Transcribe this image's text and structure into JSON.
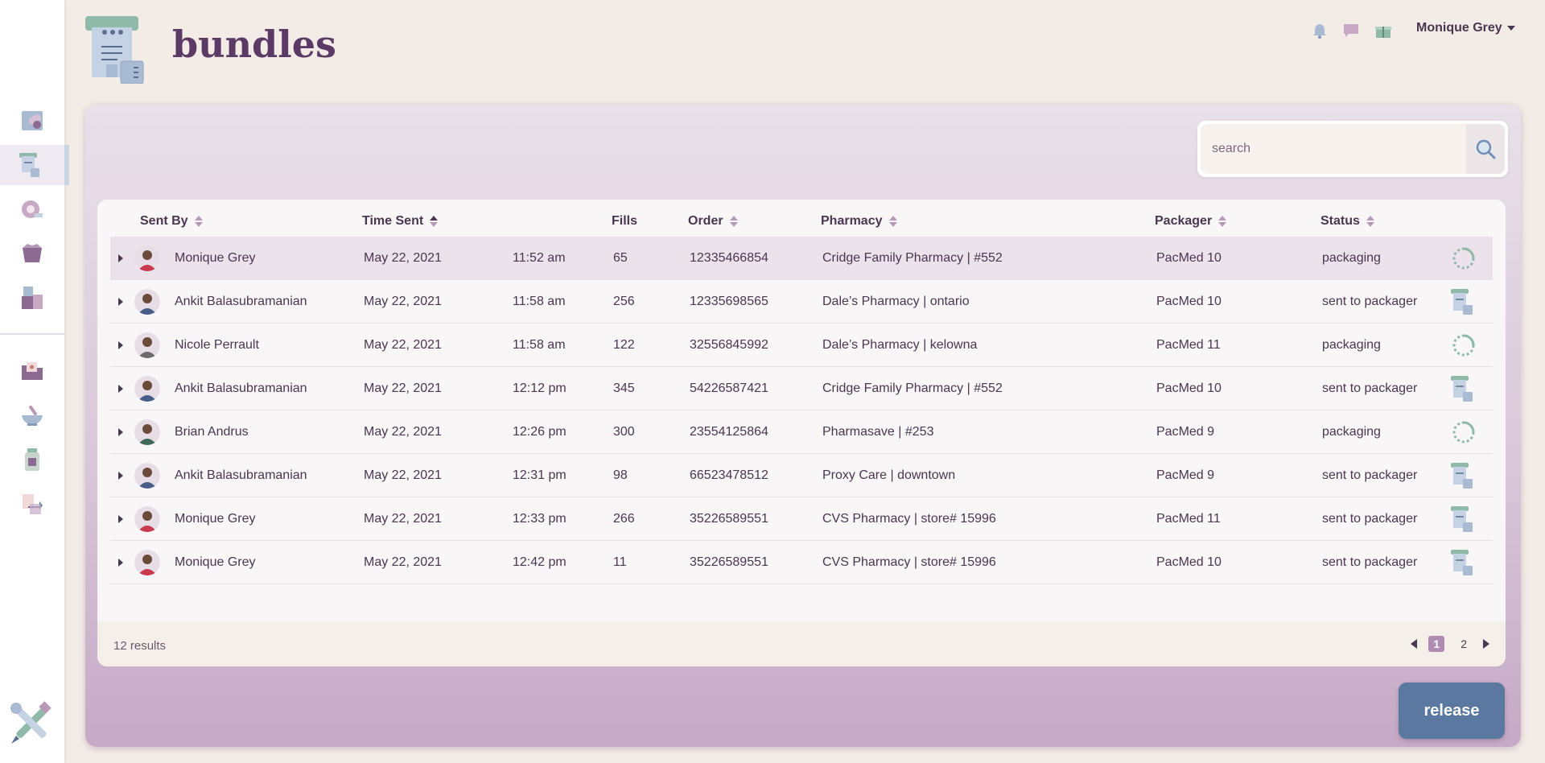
{
  "page": {
    "title": "bundles"
  },
  "header": {
    "user_name": "Monique Grey",
    "icons": [
      "bell-icon",
      "chat-icon",
      "gift-icon"
    ]
  },
  "sidebar": {
    "items": [
      {
        "name": "pills-icon",
        "active": false
      },
      {
        "name": "bundles-icon",
        "active": true
      },
      {
        "name": "tape-icon",
        "active": false
      },
      {
        "name": "box-icon",
        "active": false
      },
      {
        "name": "stack-icon",
        "active": false
      },
      {
        "name": "folder-icon",
        "active": false
      },
      {
        "name": "mortar-pestle-icon",
        "active": false
      },
      {
        "name": "bottle-icon",
        "active": false
      },
      {
        "name": "transfer-icon",
        "active": false
      }
    ],
    "footer_icon": "tools-icon"
  },
  "search": {
    "placeholder": "search",
    "value": ""
  },
  "table": {
    "columns": [
      "Sent By",
      "Time Sent",
      "Fills",
      "Order",
      "Pharmacy",
      "Packager",
      "Status"
    ],
    "rows": [
      {
        "sent_by": "Monique Grey",
        "date": "May 22, 2021",
        "time": "11:52 am",
        "fills": "65",
        "order": "12335466854",
        "pharmacy": "Cridge Family Pharmacy | #552",
        "packager": "PacMed 10",
        "status": "packaging",
        "status_icon": "spinner-icon"
      },
      {
        "sent_by": "Ankit Balasubramanian",
        "date": "May 22, 2021",
        "time": "11:58 am",
        "fills": "256",
        "order": "12335698565",
        "pharmacy": "Dale’s Pharmacy | ontario",
        "packager": "PacMed 10",
        "status": "sent to packager",
        "status_icon": "packager-icon"
      },
      {
        "sent_by": "Nicole Perrault",
        "date": "May 22, 2021",
        "time": "11:58 am",
        "fills": "122",
        "order": "32556845992",
        "pharmacy": "Dale’s Pharmacy | kelowna",
        "packager": "PacMed 11",
        "status": "packaging",
        "status_icon": "spinner-icon"
      },
      {
        "sent_by": "Ankit Balasubramanian",
        "date": "May 22, 2021",
        "time": "12:12 pm",
        "fills": "345",
        "order": "54226587421",
        "pharmacy": "Cridge Family Pharmacy | #552",
        "packager": "PacMed 10",
        "status": "sent to packager",
        "status_icon": "packager-icon"
      },
      {
        "sent_by": "Brian Andrus",
        "date": "May 22, 2021",
        "time": "12:26 pm",
        "fills": "300",
        "order": "23554125864",
        "pharmacy": "Pharmasave | #253",
        "packager": "PacMed 9",
        "status": "packaging",
        "status_icon": "spinner-icon"
      },
      {
        "sent_by": "Ankit Balasubramanian",
        "date": "May 22, 2021",
        "time": "12:31 pm",
        "fills": "98",
        "order": "66523478512",
        "pharmacy": "Proxy Care |  downtown",
        "packager": "PacMed 9",
        "status": "sent to packager",
        "status_icon": "packager-icon"
      },
      {
        "sent_by": "Monique Grey",
        "date": "May 22, 2021",
        "time": "12:33 pm",
        "fills": "266",
        "order": "35226589551",
        "pharmacy": "CVS Pharmacy | store# 15996",
        "packager": "PacMed 11",
        "status": "sent to packager",
        "status_icon": "packager-icon"
      },
      {
        "sent_by": "Monique Grey",
        "date": "May 22, 2021",
        "time": "12:42 pm",
        "fills": "11",
        "order": "35226589551",
        "pharmacy": "CVS Pharmacy | store# 15996",
        "packager": "PacMed 10",
        "status": "sent to packager",
        "status_icon": "packager-icon"
      }
    ],
    "results_text": "12 results",
    "pagination": {
      "pages": [
        "1",
        "2"
      ],
      "current": "1"
    }
  },
  "actions": {
    "release_label": "release"
  },
  "colors": {
    "accent": "#5c3a66",
    "button": "#5a78a0",
    "background": "#f3ebe5"
  }
}
